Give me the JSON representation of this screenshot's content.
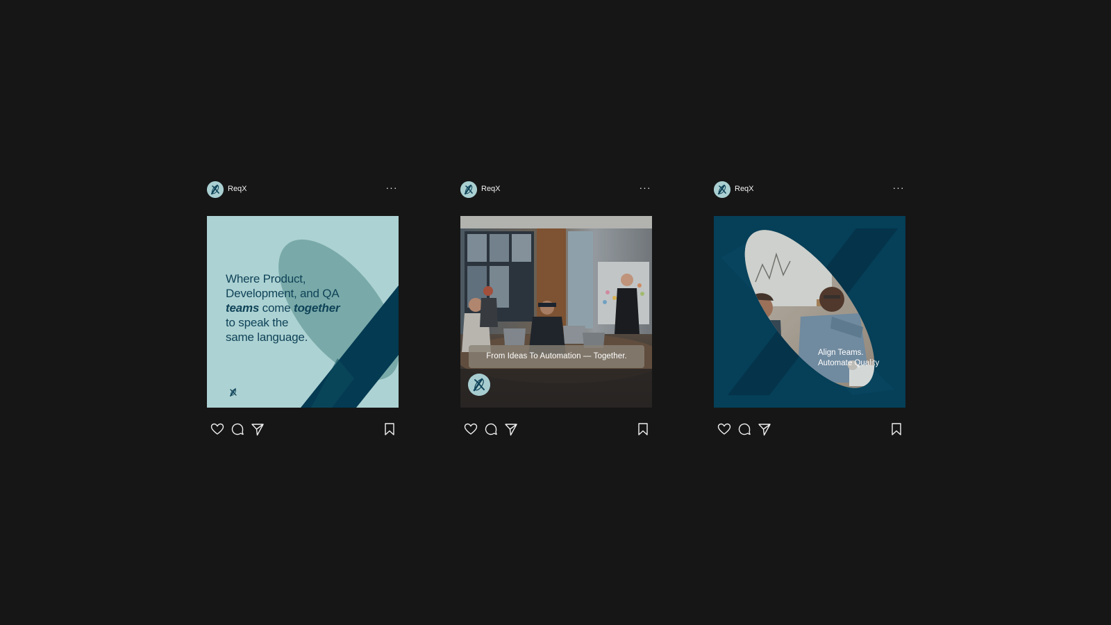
{
  "theme": {
    "background": "#161616",
    "brand_light": "#a9cfd1",
    "brand_mid": "#79aaa9",
    "brand_dark": "#043a52",
    "brand_ink": "#0f4358",
    "text_on_dark": "#f1f1f1"
  },
  "posts": [
    {
      "account": {
        "name": "ReqX",
        "avatar_icon": "reqx-logo-icon"
      },
      "menu_label": "···",
      "media": {
        "type": "text-slide",
        "lines": [
          "Where Product,",
          "Development, and QA"
        ],
        "emphasis_1": "teams",
        "connector": " come ",
        "emphasis_2": "together",
        "tail_lines": [
          "to speak the",
          "same language."
        ],
        "logo_icon": "reqx-logo-icon"
      },
      "actions": {
        "like_icon": "heart-icon",
        "comment_icon": "comment-bubble-icon",
        "share_icon": "send-icon",
        "save_icon": "bookmark-icon"
      }
    },
    {
      "account": {
        "name": "ReqX",
        "avatar_icon": "reqx-logo-icon"
      },
      "menu_label": "···",
      "media": {
        "type": "photo",
        "caption": "From Ideas To Automation — Together.",
        "logo_icon": "reqx-logo-icon"
      },
      "actions": {
        "like_icon": "heart-icon",
        "comment_icon": "comment-bubble-icon",
        "share_icon": "send-icon",
        "save_icon": "bookmark-icon"
      }
    },
    {
      "account": {
        "name": "ReqX",
        "avatar_icon": "reqx-logo-icon"
      },
      "menu_label": "···",
      "media": {
        "type": "photo-in-oval",
        "caption_lines": [
          "Align Teams.",
          "Automate Quality"
        ]
      },
      "actions": {
        "like_icon": "heart-icon",
        "comment_icon": "comment-bubble-icon",
        "share_icon": "send-icon",
        "save_icon": "bookmark-icon"
      }
    }
  ]
}
